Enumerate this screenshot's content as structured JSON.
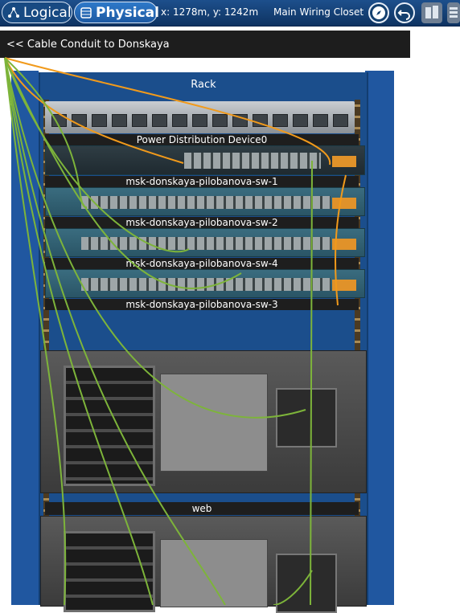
{
  "toolbar": {
    "logical_label": "Logical",
    "physical_label": "Physical",
    "coords": "x: 1278m, y: 1242m",
    "location": "Main Wiring Closet"
  },
  "conduit": {
    "label": "<< Cable Conduit to Donskaya"
  },
  "rack": {
    "title": "Rack",
    "devices": {
      "pdu": "Power Distribution Device0",
      "sw1": "msk-donskaya-pilobanova-sw-1",
      "sw2": "msk-donskaya-pilobanova-sw-2",
      "sw4": "msk-donskaya-pilobanova-sw-4",
      "sw3": "msk-donskaya-pilobanova-sw-3",
      "web": "web"
    }
  },
  "colors": {
    "toolbar": "#1d4f8c",
    "rack": "#1b4e8c",
    "cable_green": "#7db43a",
    "cable_orange": "#f19a1b"
  },
  "icons": [
    "logical-view-icon",
    "physical-view-icon",
    "navigate-icon",
    "back-icon",
    "cluster-icon",
    "menu-icon"
  ]
}
